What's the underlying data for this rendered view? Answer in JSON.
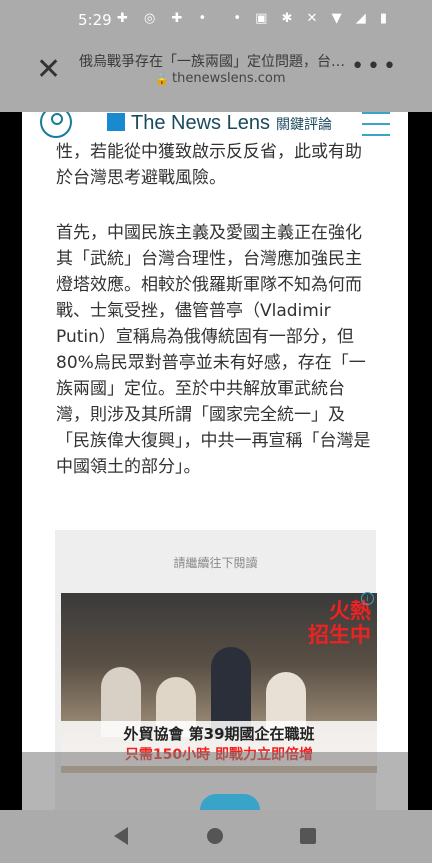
{
  "status": {
    "time": "5:29",
    "left_icons": "✚ ◎ ✚ •",
    "right_icons": "• ▣ ✱ ✕ ▼ ◢ ▮"
  },
  "chrome": {
    "title": "俄烏戰爭存在「一族兩國」定位問題，台…",
    "url": "thenewslens.com"
  },
  "site": {
    "logo_text": "The News Lens",
    "logo_cn": "關鍵評論"
  },
  "article": {
    "p0": "性，若能從中獲致啟示反反省，此或有助於台灣思考避戰風險。",
    "p1": "首先，中國民族主義及愛國主義正在強化其「武統」台灣合理性，台灣應加強民主燈塔效應。相較於俄羅斯軍隊不知為何而戰、士氣受挫，儘管普亭（Vladimir Putin）宣稱烏為俄傳統固有一部分，但80%烏民眾對普亭並未有好感，存在「一族兩國」定位。至於中共解放軍武統台灣，則涉及其所謂「國家完全統一」及「民族偉大復興」，中共一再宣稱「台灣是中國領土的部分」。"
  },
  "ad": {
    "caption": "請繼續往下閱讀",
    "hot_line1": "火熱",
    "hot_line2": "招生中",
    "line1": "外貿協會 第39期國企在職班",
    "line2": "只需150小時 即戰力立即倍增",
    "info": "i"
  },
  "colors": {
    "accent": "#3aa3c8",
    "ad_red": "#e22222"
  }
}
